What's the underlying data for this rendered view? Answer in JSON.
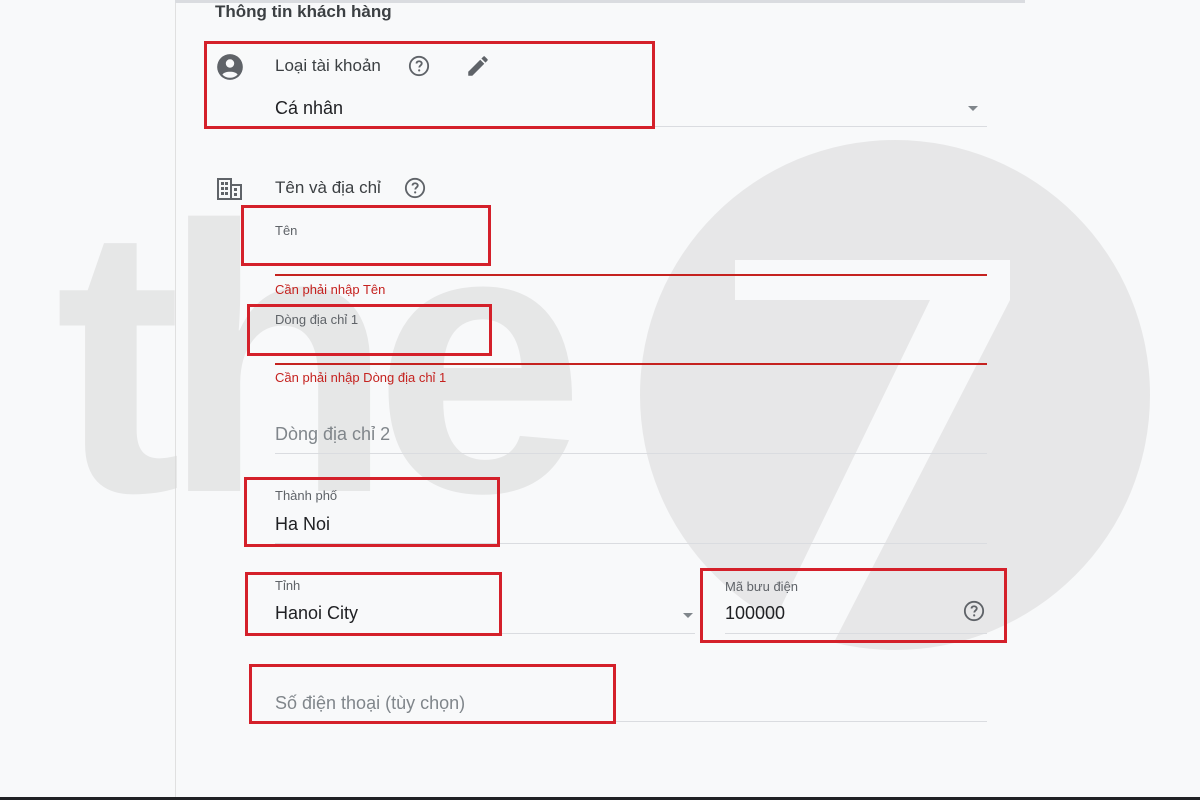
{
  "section": {
    "title": "Thông tin khách hàng"
  },
  "account": {
    "label": "Loại tài khoản",
    "value": "Cá nhân",
    "icons": [
      "account-circle-icon",
      "help-icon",
      "edit-icon",
      "dropdown-caret-icon"
    ]
  },
  "name_address": {
    "label": "Tên và địa chỉ",
    "icons": [
      "building-icon",
      "help-icon"
    ]
  },
  "fields": {
    "name": {
      "label": "Tên",
      "value": "",
      "error": "Cần phải nhập Tên"
    },
    "address1": {
      "label": "Dòng địa chỉ 1",
      "value": "",
      "error": "Cần phải nhập Dòng địa chỉ 1"
    },
    "address2": {
      "placeholder": "Dòng địa chỉ 2"
    },
    "city": {
      "label": "Thành phố",
      "value": "Ha Noi"
    },
    "province": {
      "label": "Tỉnh",
      "value": "Hanoi City"
    },
    "postal": {
      "label": "Mã bưu điện",
      "value": "100000"
    },
    "phone": {
      "placeholder": "Số điện thoại (tùy chọn)"
    }
  },
  "watermark": {
    "text": "the",
    "numeral": "7"
  },
  "colors": {
    "highlight": "#d4202a",
    "error": "#c5221f",
    "watermark": "#d9d9d9"
  }
}
